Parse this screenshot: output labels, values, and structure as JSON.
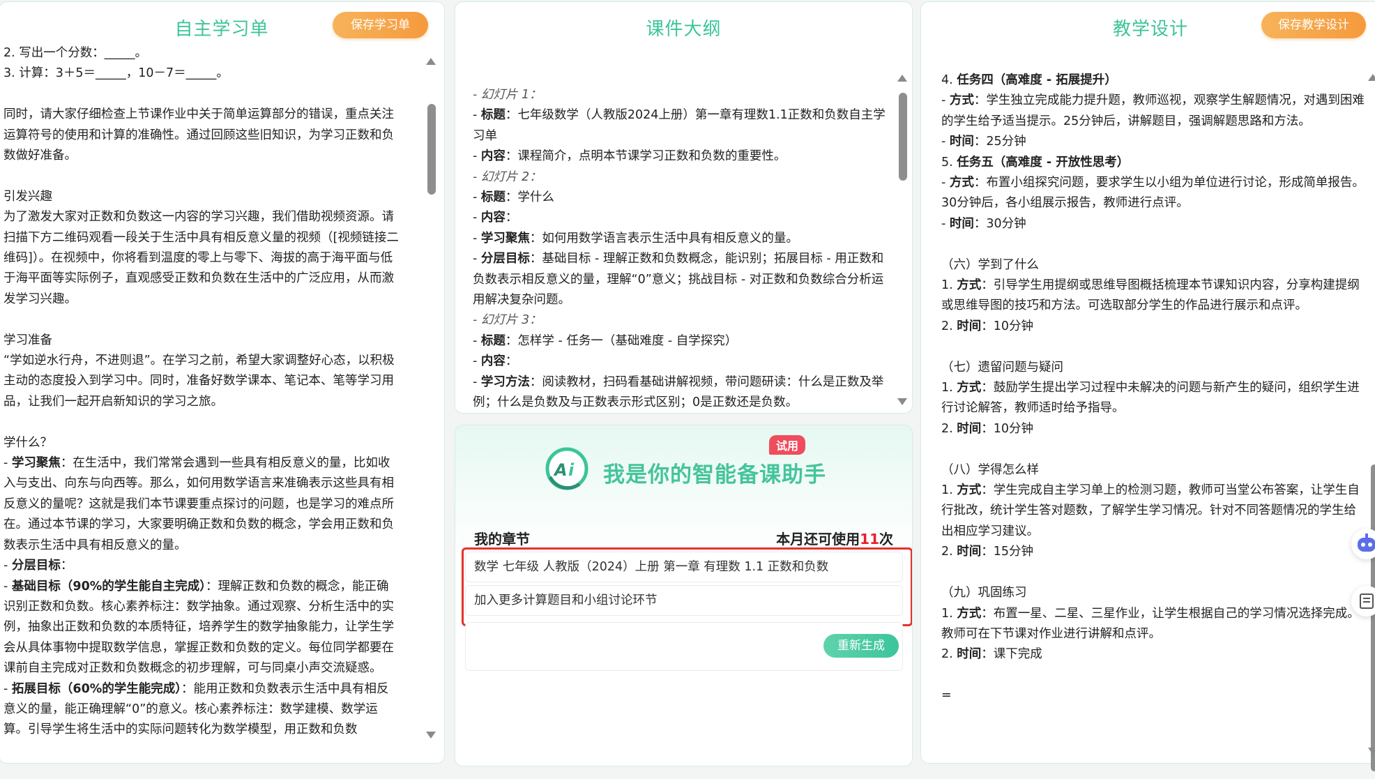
{
  "left": {
    "title": "自主学习单",
    "save_label": "保存学习单",
    "lines_top": [
      "2. 写出一个分数：_____。",
      "3. 计算：3＋5＝_____，10－7＝_____。"
    ],
    "p1": "同时，请大家仔细检查上节课作业中关于简单运算部分的错误，重点关注运算符号的使用和计算的准确性。通过回顾这些旧知识，为学习正数和负数做好准备。",
    "h_interest": "引发兴趣",
    "p_interest": "为了激发大家对正数和负数这一内容的学习兴趣，我们借助视频资源。请扫描下方二维码观看一段关于生活中具有相反意义量的视频（[视频链接二维码]）。在视频中，你将看到温度的零上与零下、海拔的高于海平面与低于海平面等实际例子，直观感受正数和负数在生活中的广泛应用，从而激发学习兴趣。",
    "h_prep": "学习准备",
    "p_prep": "“学如逆水行舟，不进则退”。在学习之前，希望大家调整好心态，以积极主动的态度投入到学习中。同时，准备好数学课本、笔记本、笔等学习用品，让我们一起开启新知识的学习之旅。",
    "h_what": "学什么？",
    "focus_label": "学习聚焦",
    "focus_text": "：在生活中，我们常常会遇到一些具有相反意义的量，比如收入与支出、向东与向西等。那么，如何用数学语言来准确表示这些具有相反意义的量呢？这就是我们本节课要重点探讨的问题，也是学习的难点所在。通过本节课的学习，大家要明确正数和负数的概念，学会用正数和负数表示生活中具有相反意义的量。",
    "layer_label": "分层目标",
    "layer_colon": "：",
    "basic_label": "基础目标（90%的学生能自主完成）",
    "basic_text": "：理解正数和负数的概念，能正确识别正数和负数。核心素养标注：数学抽象。通过观察、分析生活中的实例，抽象出正数和负数的本质特征，培养学生的数学抽象能力，让学生学会从具体事物中提取数学信息，掌握正数和负数的定义。每位同学都要在课前自主完成对正数和负数概念的初步理解，可与同桌小声交流疑惑。",
    "ext_label": "拓展目标（60%的学生能完成）",
    "ext_text": "：能用正数和负数表示生活中具有相反意义的量，能正确理解“0”的意义。核心素养标注：数学建模、数学运算。引导学生将生活中的实际问题转化为数学模型，用正数和负数"
  },
  "middle": {
    "title": "课件大纲",
    "lines": [
      {
        "type": "italic",
        "text": "- 幻灯片 1："
      },
      {
        "type": "kv",
        "label": "标题",
        "text": "：七年级数学（人教版2024上册）第一章有理数1.1正数和负数自主学习单"
      },
      {
        "type": "kv",
        "label": "内容",
        "text": "：课程简介，点明本节课学习正数和负数的重要性。"
      },
      {
        "type": "italic",
        "text": "- 幻灯片 2："
      },
      {
        "type": "kv",
        "label": "标题",
        "text": "：学什么"
      },
      {
        "type": "kv",
        "label": "内容",
        "text": "："
      },
      {
        "type": "kv",
        "label": "学习聚焦",
        "text": "：如何用数学语言表示生活中具有相反意义的量。"
      },
      {
        "type": "kv",
        "label": "分层目标",
        "text": "：基础目标 - 理解正数和负数概念，能识别；拓展目标 - 用正数和负数表示相反意义的量，理解“0”意义；挑战目标 - 对正数和负数综合分析运用解决复杂问题。"
      },
      {
        "type": "italic",
        "text": "- 幻灯片 3："
      },
      {
        "type": "kv",
        "label": "标题",
        "text": "：怎样学 - 任务一（基础难度 - 自学探究）"
      },
      {
        "type": "kv",
        "label": "内容",
        "text": "："
      },
      {
        "type": "kv",
        "label": "学习方法",
        "text": "：阅读教材，扫码看基础讲解视频，带问题研读：什么是正数及举例；什么是负数及与正数表示形式区别；0是正数还是负数。"
      }
    ]
  },
  "assistant": {
    "title": "我是你的智能备课助手",
    "trial": "试用",
    "chapter_label": "我的章节",
    "usage_prefix": "本月还可使用",
    "usage_count": "11",
    "usage_suffix": "次",
    "chapter_value": "数学 七年级 人教版（2024）上册 第一章 有理数 1.1 正数和负数",
    "requirement_value": "加入更多计算题目和小组讨论环节",
    "regen_label": "重新生成"
  },
  "right": {
    "title": "教学设计",
    "save_label": "保存教学设计",
    "lines": [
      {
        "type": "head",
        "text": "4. ",
        "bold": "任务四（高难度 - 拓展提升）"
      },
      {
        "type": "kv",
        "label": "方式",
        "text": "：学生独立完成能力提升题，教师巡视，观察学生解题情况，对遇到困难的学生给予适当提示。25分钟后，讲解题目，强调解题思路和方法。"
      },
      {
        "type": "kv",
        "label": "时间",
        "text": "：25分钟"
      },
      {
        "type": "head",
        "text": "5. ",
        "bold": "任务五（高难度 - 开放性思考）"
      },
      {
        "type": "kv",
        "label": "方式",
        "text": "：布置小组探究问题，要求学生以小组为单位进行讨论，形成简单报告。30分钟后，各小组展示报告，教师进行点评。"
      },
      {
        "type": "kv",
        "label": "时间",
        "text": "：30分钟"
      },
      {
        "type": "gap"
      },
      {
        "type": "plain",
        "text": "（六）学到了什么"
      },
      {
        "type": "num",
        "num": "1. ",
        "label": "方式",
        "text": "：引导学生用提纲或思维导图概括梳理本节课知识内容，分享构建提纲或思维导图的技巧和方法。可选取部分学生的作品进行展示和点评。"
      },
      {
        "type": "num",
        "num": "2. ",
        "label": "时间",
        "text": "：10分钟"
      },
      {
        "type": "gap"
      },
      {
        "type": "plain",
        "text": "（七）遗留问题与疑问"
      },
      {
        "type": "num",
        "num": "1. ",
        "label": "方式",
        "text": "：鼓励学生提出学习过程中未解决的问题与新产生的疑问，组织学生进行讨论解答，教师适时给予指导。"
      },
      {
        "type": "num",
        "num": "2. ",
        "label": "时间",
        "text": "：10分钟"
      },
      {
        "type": "gap"
      },
      {
        "type": "plain",
        "text": "（八）学得怎么样"
      },
      {
        "type": "num",
        "num": "1. ",
        "label": "方式",
        "text": "：学生完成自主学习单上的检测习题，教师可当堂公布答案，让学生自行批改，统计学生答对题数，了解学生学习情况。针对不同答题情况的学生给出相应学习建议。"
      },
      {
        "type": "num",
        "num": "2. ",
        "label": "时间",
        "text": "：15分钟"
      },
      {
        "type": "gap"
      },
      {
        "type": "plain",
        "text": "（九）巩固练习"
      },
      {
        "type": "num",
        "num": "1. ",
        "label": "方式",
        "text": "：布置一星、二星、三星作业，让学生根据自己的学习情况选择完成。教师可在下节课对作业进行讲解和点评。"
      },
      {
        "type": "num",
        "num": "2. ",
        "label": "时间",
        "text": "：课下完成"
      },
      {
        "type": "gap"
      },
      {
        "type": "plain",
        "text": "="
      }
    ]
  },
  "colors": {
    "accent_green": "#3cc49a",
    "save_orange": "#f59a3d",
    "alert_red": "#e3322b",
    "usage_red": "#e8202c"
  },
  "icons": [
    "ai-logo-icon",
    "assistant-robot-icon",
    "notes-icon"
  ]
}
